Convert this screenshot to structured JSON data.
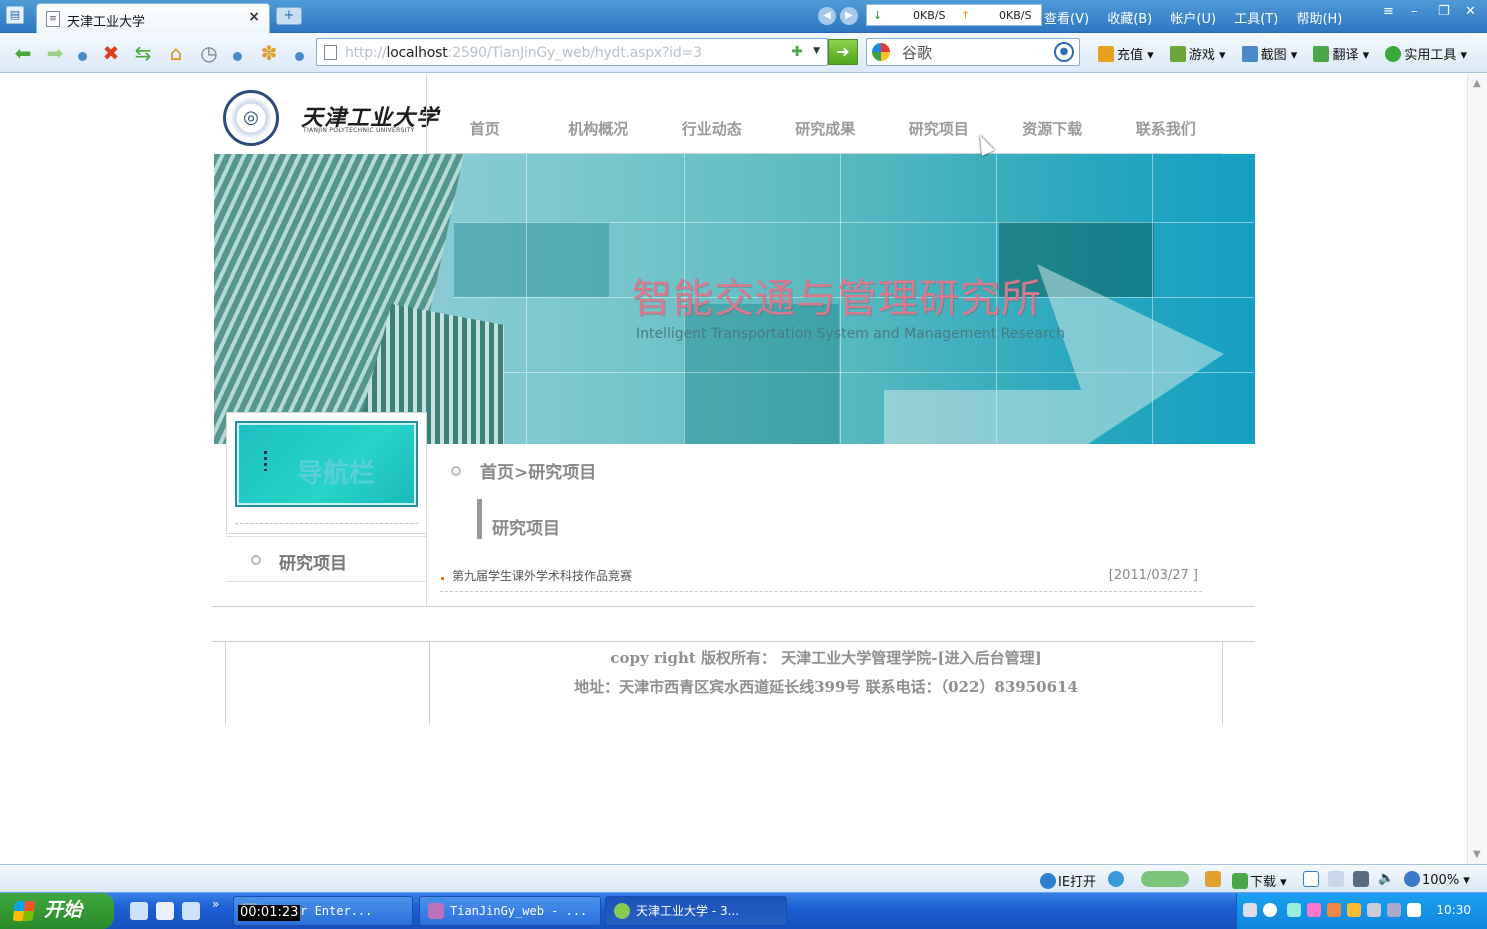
{
  "browser": {
    "tab_title": "天津工业大学",
    "tab_close": "×",
    "new_tab": "+",
    "speed_down": "0KB/S",
    "speed_up": "0KB/S",
    "menu": [
      "查看(V)",
      "收藏(B)",
      "帐户(U)",
      "工具(T)",
      "帮助(H)"
    ],
    "address_prefix": "http://",
    "address_host": "localhost",
    "address_rest": ":2590/TianJinGy_web/hydt.aspx?id=3",
    "search_value": "谷歌",
    "tools": [
      "充值",
      "游戏",
      "截图",
      "翻译",
      "实用工具"
    ]
  },
  "site": {
    "name_cn": "天津工业大学",
    "name_en": "TIANJIN POLYTECHNIC UNIVERSITY",
    "nav": [
      "首页",
      "机构概况",
      "行业动态",
      "研究成果",
      "研究项目",
      "资源下载",
      "联系我们"
    ],
    "banner_title": "智能交通与管理研究所",
    "banner_subtitle": "Intelligent Transportation System and Management Research",
    "sidebar_title": "导航栏",
    "sidebar_items": [
      "研究项目"
    ],
    "breadcrumb": "首页>研究项目",
    "section_title": "研究项目",
    "news": [
      {
        "title": "第九届学生课外学术科技作品竞赛",
        "date": "[2011/03/27 ]"
      }
    ],
    "footer_line1": "copy right 版权所有： 天津工业大学管理学院-[进入后台管理]",
    "footer_line2": "地址：天津市西青区宾水西道延长线399号 联系电话：（022）83950614"
  },
  "status": {
    "ie_open": "IE打开",
    "download": "下载",
    "zoom": "100%"
  },
  "taskbar": {
    "start": "开始",
    "timer": "00:01:23",
    "tasks": [
      "Server Enter...",
      "TianJinGy_web - ...",
      "天津工业大学 - 3..."
    ],
    "clock": "10:30"
  }
}
